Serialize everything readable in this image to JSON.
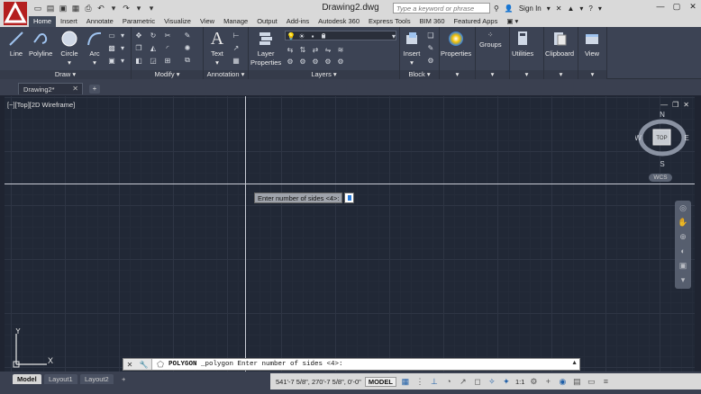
{
  "window": {
    "title": "Drawing2.dwg",
    "search_placeholder": "Type a keyword or phrase",
    "sign_in": "Sign In"
  },
  "ribbon": {
    "tabs": [
      "Home",
      "Insert",
      "Annotate",
      "Parametric",
      "Visualize",
      "View",
      "Manage",
      "Output",
      "Add-ins",
      "Autodesk 360",
      "Express Tools",
      "BIM 360",
      "Featured Apps"
    ],
    "active_tab": "Home",
    "draw": {
      "title": "Draw",
      "line": "Line",
      "polyline": "Polyline",
      "circle": "Circle",
      "arc": "Arc"
    },
    "modify": {
      "title": "Modify"
    },
    "annotation": {
      "title": "Annotation",
      "text": "Text"
    },
    "layers": {
      "title": "Layers",
      "layer_properties_1": "Layer",
      "layer_properties_2": "Properties",
      "current_layer": "0"
    },
    "block": {
      "title": "Block",
      "insert": "Insert"
    },
    "properties": "Properties",
    "groups": "Groups",
    "utilities": "Utilities",
    "clipboard": "Clipboard",
    "view": "View"
  },
  "file_tabs": {
    "active": "Drawing2*"
  },
  "viewport": {
    "label": "[−][Top][2D Wireframe]",
    "dynamic_prompt": "Enter number of sides <4>:",
    "viewcube": {
      "n": "N",
      "s": "S",
      "e": "E",
      "w": "W",
      "face": "TOP",
      "wcs": "WCS"
    },
    "ucs": {
      "x": "X",
      "y": "Y"
    }
  },
  "command_line": {
    "command": "POLYGON",
    "text": "_polygon Enter number of sides <4>:"
  },
  "status": {
    "layouts": [
      "Model",
      "Layout1",
      "Layout2"
    ],
    "coordinates": "541'-7 5/8\", 270'-7 5/8\", 0'-0\"",
    "model": "MODEL",
    "scale": "1:1"
  },
  "colors": {
    "canvas": "#212836",
    "ribbon": "#3c4354",
    "accent": "#1f5fa8",
    "app_red": "#b41f1f"
  }
}
